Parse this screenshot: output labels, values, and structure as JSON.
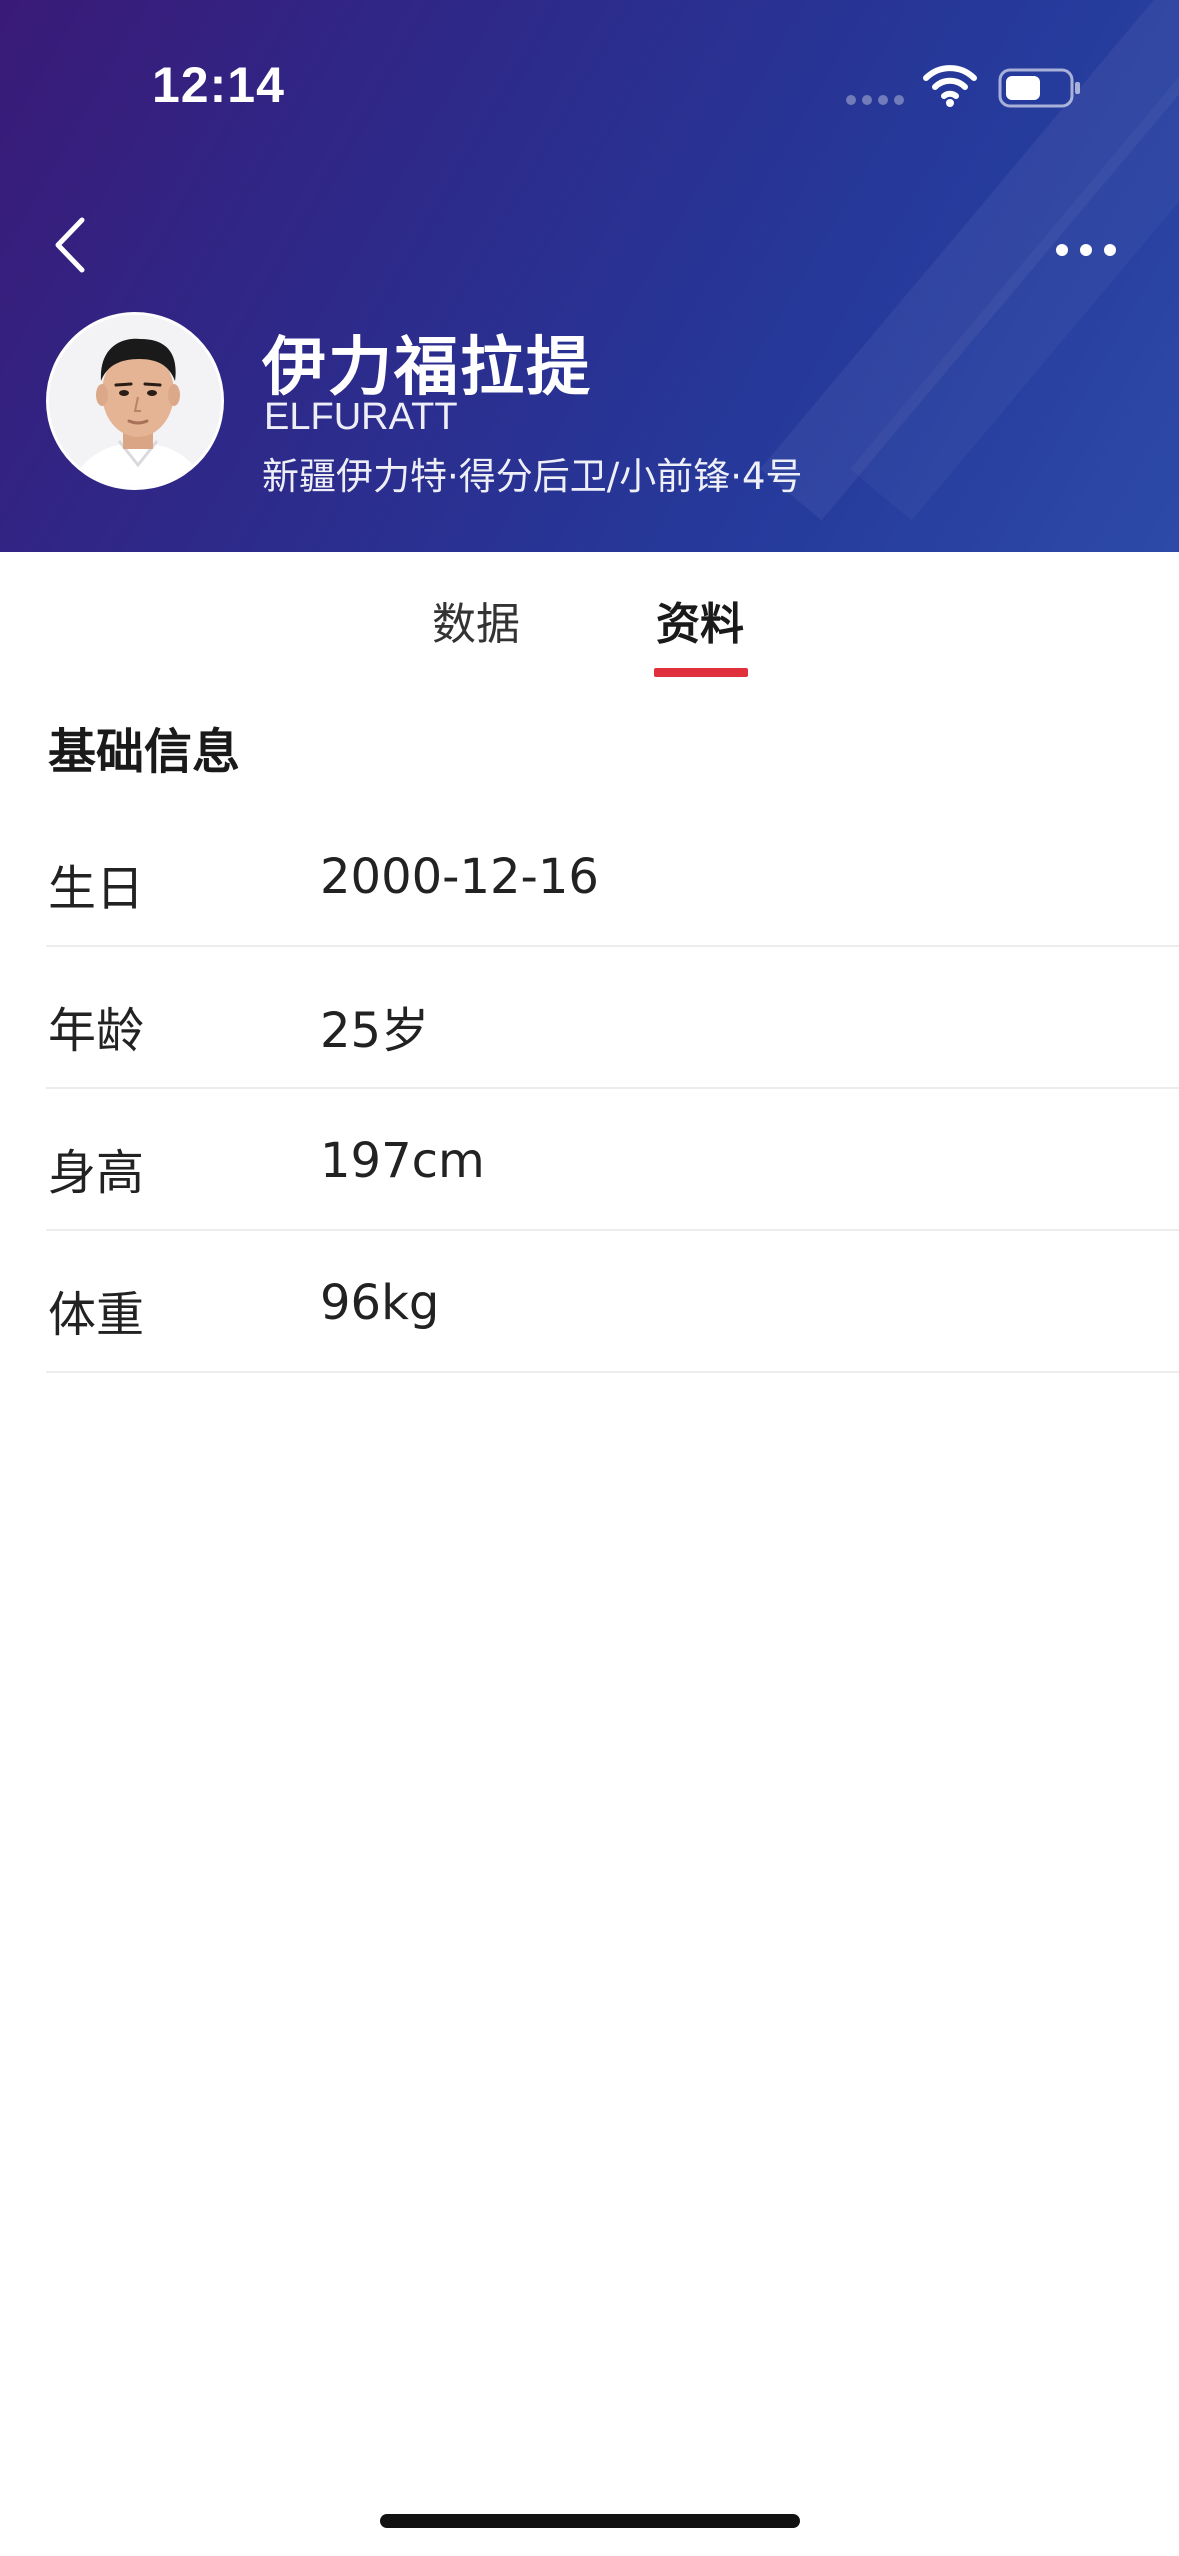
{
  "status_bar": {
    "time": "12:14"
  },
  "header": {
    "player_name": "伊力福拉提",
    "player_name_en": "ELFURATT",
    "player_meta": "新疆伊力特·得分后卫/小前锋·4号",
    "back_icon": "chevron-left-icon",
    "more_icon": "more-horizontal-icon"
  },
  "tabs": [
    {
      "label": "数据",
      "active": false
    },
    {
      "label": "资料",
      "active": true
    }
  ],
  "tab_indicator_color": "#e0303c",
  "section": {
    "title": "基础信息",
    "rows": [
      {
        "label": "生日",
        "value": "2000-12-16"
      },
      {
        "label": "年龄",
        "value": "25岁"
      },
      {
        "label": "身高",
        "value": "197cm"
      },
      {
        "label": "体重",
        "value": "96kg"
      }
    ]
  }
}
